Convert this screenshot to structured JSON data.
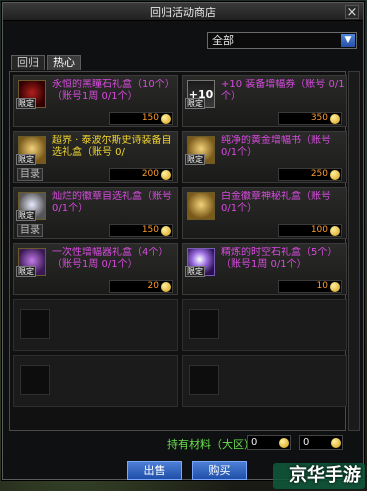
{
  "window": {
    "title": "回归活动商店"
  },
  "filter": {
    "selected": "全部"
  },
  "tabs": [
    {
      "label": "回归"
    },
    {
      "label": "热心"
    }
  ],
  "items": [
    {
      "name": "永恒的黑瞳石礼盒（10个）（账号1周 0/1个）",
      "price": "150",
      "badge": "限定",
      "catalog": "",
      "name_color": "purple",
      "icon": "red"
    },
    {
      "name": "+10 装备增幅券（账号 0/1个）",
      "price": "350",
      "badge": "限定",
      "catalog": "",
      "name_color": "purple",
      "icon": "plus10"
    },
    {
      "name": "超界 · 泰波尔斯史诗装备自选礼盒（账号 0/",
      "price": "200",
      "badge": "限定",
      "catalog": "目录",
      "name_color": "gold",
      "icon": "gold"
    },
    {
      "name": "纯净的黄金增幅书（账号 0/1个）",
      "price": "250",
      "badge": "限定",
      "catalog": "",
      "name_color": "purple",
      "icon": "gold"
    },
    {
      "name": "灿烂的徽章自选礼盒（账号 0/1个）",
      "price": "150",
      "badge": "限定",
      "catalog": "目录",
      "name_color": "purple",
      "icon": "white"
    },
    {
      "name": "白金徽章神秘礼盒（账号 0/1个）",
      "price": "100",
      "badge": "",
      "catalog": "",
      "name_color": "purple",
      "icon": "gold"
    },
    {
      "name": "一次性增幅器礼盒（4个）（账号1周 0/1个）",
      "price": "20",
      "badge": "限定",
      "catalog": "",
      "name_color": "purple",
      "icon": "purple"
    },
    {
      "name": "精炼的时空石礼盒（5个）（账号1周 0/1个）",
      "price": "10",
      "badge": "限定",
      "catalog": "",
      "name_color": "purple",
      "icon": "orb"
    }
  ],
  "materials": {
    "label": "持有材料（大区）:",
    "value_a": "0",
    "value_b": "0"
  },
  "buttons": {
    "sell": "出售",
    "buy": "购买"
  },
  "watermark": "京华手游"
}
